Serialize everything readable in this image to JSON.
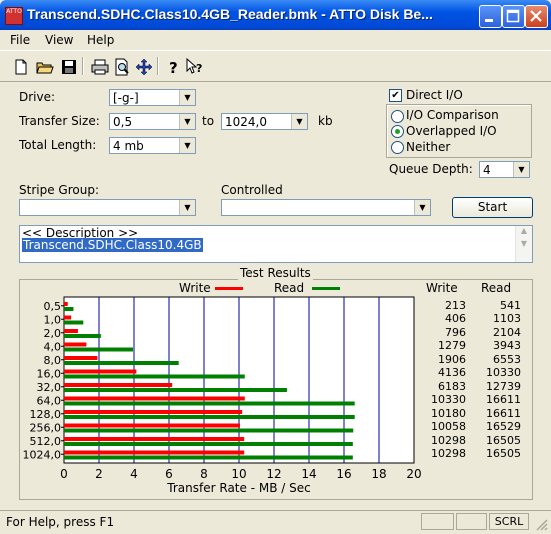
{
  "window": {
    "title": "Transcend.SDHC.Class10.4GB_Reader.bmk - ATTO Disk Be...",
    "app_icon_text": "ATTO"
  },
  "menu": [
    "File",
    "View",
    "Help"
  ],
  "toolbar_icons": [
    "new-file-icon",
    "open-folder-icon",
    "save-icon",
    "print-icon",
    "print-preview-icon",
    "move-icon",
    "help-icon",
    "context-help-icon"
  ],
  "form": {
    "drive_label": "Drive:",
    "drive_value": "[-g-]",
    "transfer_size_label": "Transfer Size:",
    "transfer_from": "0,5",
    "to_label": "to",
    "transfer_to": "1024,0",
    "kb_label": "kb",
    "total_length_label": "Total Length:",
    "total_length_value": "4 mb",
    "direct_io_label": "Direct I/O",
    "direct_io_checked": true,
    "io_comparison_label": "I/O Comparison",
    "overlapped_io_label": "Overlapped I/O",
    "neither_label": "Neither",
    "selected_mode": "Overlapped I/O",
    "queue_depth_label": "Queue Depth:",
    "queue_depth_value": "4",
    "stripe_group_label": "Stripe Group:",
    "stripe_group_value": "",
    "controlled_label": "Controlled",
    "controlled_value": "",
    "start_button": "Start",
    "description_header": "<< Description >>",
    "description_text": "Transcend.SDHC.Class10.4GB"
  },
  "results": {
    "title": "Test Results",
    "write_legend": "Write",
    "read_legend": "Read",
    "write_color": "#ff0000",
    "read_color": "#008000",
    "write_col_header": "Write",
    "read_col_header": "Read",
    "xlabel": "Transfer Rate - MB / Sec"
  },
  "chart_data": {
    "type": "bar",
    "orientation": "horizontal",
    "categories": [
      "0,5",
      "1,0",
      "2,0",
      "4,0",
      "8,0",
      "16,0",
      "32,0",
      "64,0",
      "128,0",
      "256,0",
      "512,0",
      "1024,0"
    ],
    "series": [
      {
        "name": "Write",
        "values": [
          213,
          406,
          796,
          1279,
          1906,
          4136,
          6183,
          10330,
          10180,
          10058,
          10298,
          10298
        ]
      },
      {
        "name": "Read",
        "values": [
          541,
          1103,
          2104,
          3943,
          6553,
          10330,
          12739,
          16611,
          16611,
          16529,
          16505,
          16505
        ]
      }
    ],
    "xlabel": "Transfer Rate - MB / Sec",
    "xlim": [
      0,
      20
    ],
    "xticks": [
      "0",
      "2",
      "4",
      "6",
      "8",
      "10",
      "12",
      "14",
      "16",
      "18",
      "20"
    ],
    "grid": true
  },
  "statusbar": {
    "help_text": "For Help, press F1",
    "indicator": "SCRL"
  }
}
